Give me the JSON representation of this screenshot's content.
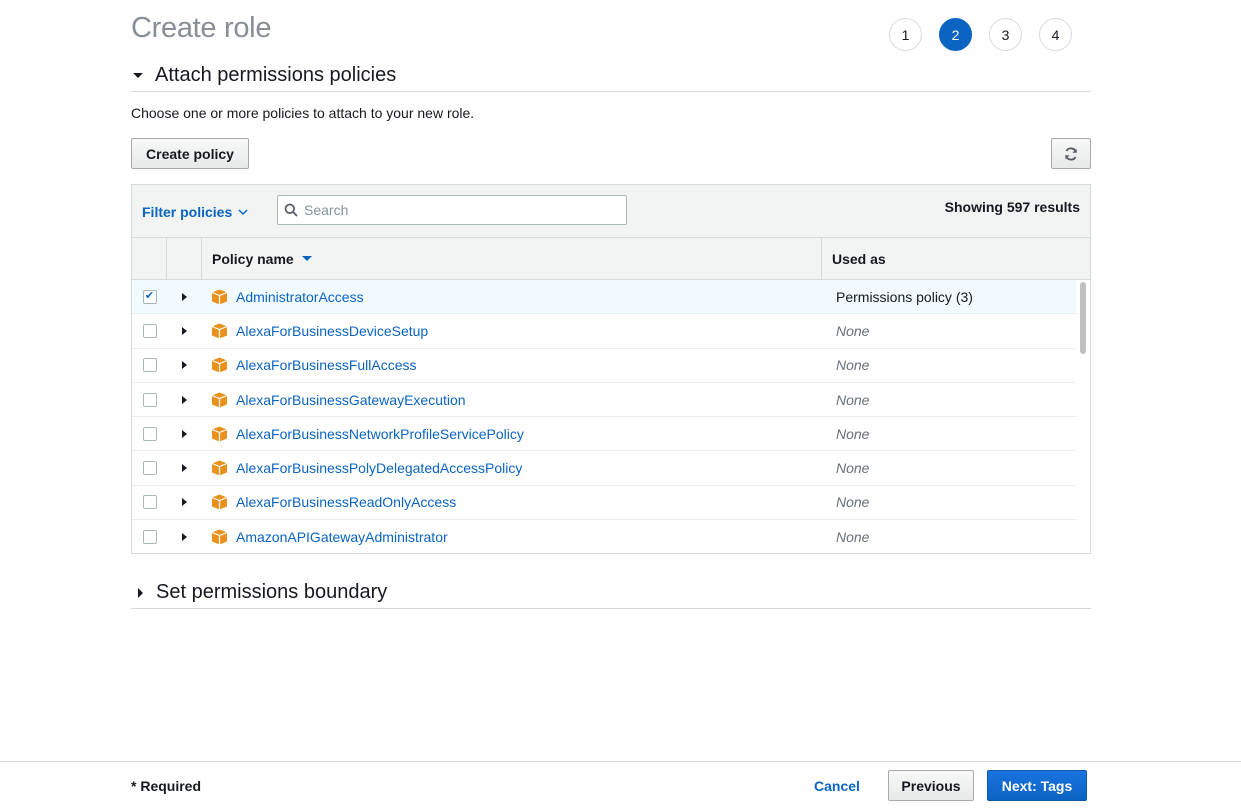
{
  "page": {
    "title": "Create role"
  },
  "steps": [
    "1",
    "2",
    "3",
    "4"
  ],
  "active_step": "2",
  "attach_section": {
    "title": "Attach permissions policies",
    "description": "Choose one or more policies to attach to your new role."
  },
  "toolbar": {
    "create_policy_label": "Create policy"
  },
  "filter": {
    "label": "Filter policies",
    "search_placeholder": "Search",
    "results_text": "Showing 597 results"
  },
  "table": {
    "columns": {
      "policy_name": "Policy name",
      "used_as": "Used as"
    },
    "rows": [
      {
        "name": "AdministratorAccess",
        "used_as": "Permissions policy (3)",
        "checked": true
      },
      {
        "name": "AlexaForBusinessDeviceSetup",
        "used_as": "None",
        "checked": false
      },
      {
        "name": "AlexaForBusinessFullAccess",
        "used_as": "None",
        "checked": false
      },
      {
        "name": "AlexaForBusinessGatewayExecution",
        "used_as": "None",
        "checked": false
      },
      {
        "name": "AlexaForBusinessNetworkProfileServicePolicy",
        "used_as": "None",
        "checked": false
      },
      {
        "name": "AlexaForBusinessPolyDelegatedAccessPolicy",
        "used_as": "None",
        "checked": false
      },
      {
        "name": "AlexaForBusinessReadOnlyAccess",
        "used_as": "None",
        "checked": false
      },
      {
        "name": "AmazonAPIGatewayAdministrator",
        "used_as": "None",
        "checked": false
      }
    ]
  },
  "boundary_section": {
    "title": "Set permissions boundary"
  },
  "footer": {
    "required_label": "* Required",
    "cancel_label": "Cancel",
    "previous_label": "Previous",
    "next_label": "Next: Tags"
  },
  "colors": {
    "accent": "#0b64c2",
    "package_icon": "#e8911c"
  }
}
